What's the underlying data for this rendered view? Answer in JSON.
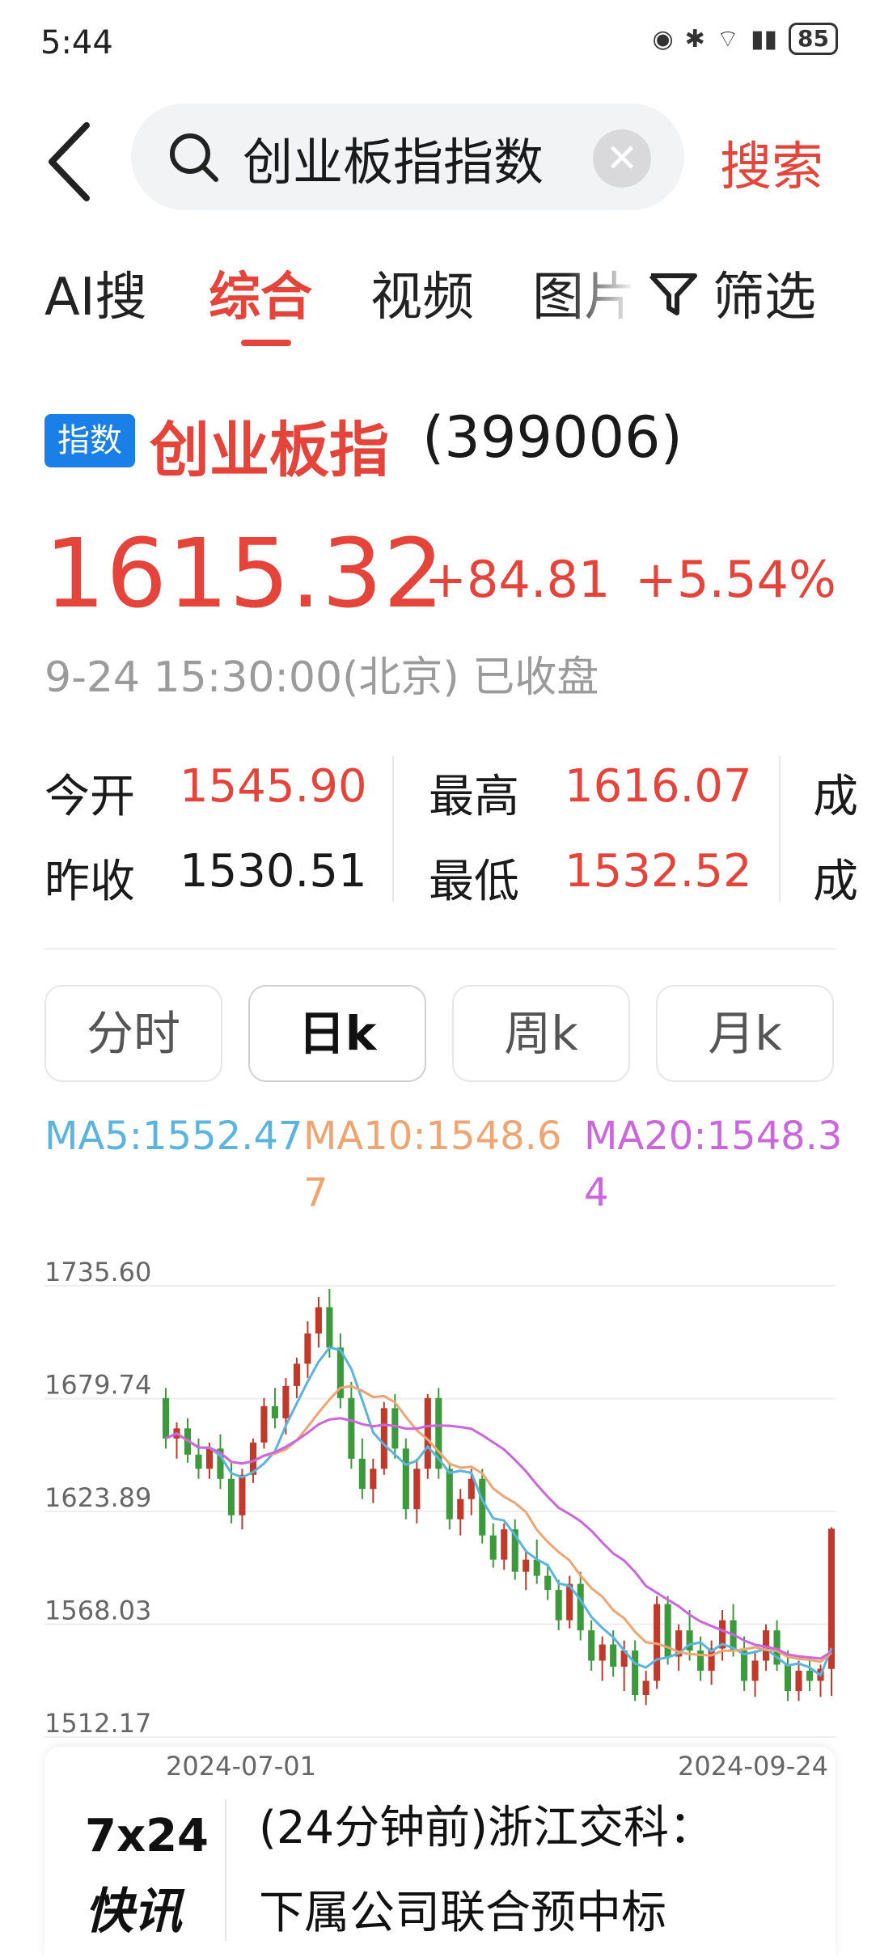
{
  "status": {
    "time": "5:44",
    "battery": "85"
  },
  "search": {
    "query": "创业板指指数",
    "button": "搜索"
  },
  "tabs": [
    "AI搜",
    "综合",
    "视频",
    "图片"
  ],
  "filter_label": "筛选",
  "quote": {
    "badge": "指数",
    "name": "创业板指",
    "code": "(399006)",
    "price": "1615.32",
    "change": "+84.81",
    "change_pct": "+5.54%",
    "time": "9-24 15:30:00(北京) 已收盘",
    "stats": {
      "open_label": "今开",
      "open": "1545.90",
      "high_label": "最高",
      "high": "1616.07",
      "prev_label": "昨收",
      "prev": "1530.51",
      "low_label": "最低",
      "low": "1532.52",
      "vol_label": "成",
      "amt_label": "成"
    }
  },
  "period_tabs": [
    "分时",
    "日k",
    "周k",
    "月k"
  ],
  "ma": {
    "ma5": "MA5:1552.47",
    "ma10": "MA10:1548.67",
    "ma20": "MA20:1548.34"
  },
  "colors": {
    "red": "#e5443b",
    "blue": "#1a7fe6",
    "up_candle": "#c0392b",
    "down_candle": "#3c9a3c",
    "ma5": "#5bb4dd",
    "ma10": "#efa572",
    "ma20": "#cc66dd"
  },
  "chart_data": {
    "type": "candlestick",
    "y_ticks": [
      "1735.60",
      "1679.74",
      "1623.89",
      "1568.03",
      "1512.17"
    ],
    "ylim": [
      1512.17,
      1735.6
    ],
    "x_labels": [
      "2024-07-01",
      "2024-09-24"
    ],
    "candles": [
      [
        1680,
        1685,
        1655,
        1660
      ],
      [
        1660,
        1668,
        1650,
        1665
      ],
      [
        1665,
        1670,
        1648,
        1652
      ],
      [
        1652,
        1660,
        1640,
        1645
      ],
      [
        1645,
        1658,
        1640,
        1655
      ],
      [
        1655,
        1662,
        1635,
        1640
      ],
      [
        1640,
        1648,
        1618,
        1622
      ],
      [
        1622,
        1645,
        1615,
        1642
      ],
      [
        1642,
        1660,
        1638,
        1658
      ],
      [
        1658,
        1680,
        1655,
        1676
      ],
      [
        1676,
        1685,
        1665,
        1670
      ],
      [
        1670,
        1690,
        1662,
        1686
      ],
      [
        1686,
        1700,
        1680,
        1697
      ],
      [
        1697,
        1718,
        1690,
        1712
      ],
      [
        1712,
        1730,
        1705,
        1725
      ],
      [
        1725,
        1734,
        1700,
        1705
      ],
      [
        1705,
        1712,
        1675,
        1680
      ],
      [
        1680,
        1688,
        1645,
        1650
      ],
      [
        1650,
        1660,
        1630,
        1635
      ],
      [
        1635,
        1650,
        1628,
        1645
      ],
      [
        1645,
        1678,
        1642,
        1675
      ],
      [
        1675,
        1682,
        1650,
        1655
      ],
      [
        1655,
        1660,
        1620,
        1625
      ],
      [
        1625,
        1650,
        1618,
        1645
      ],
      [
        1645,
        1682,
        1640,
        1680
      ],
      [
        1680,
        1685,
        1640,
        1645
      ],
      [
        1645,
        1648,
        1615,
        1620
      ],
      [
        1620,
        1635,
        1612,
        1630
      ],
      [
        1630,
        1645,
        1622,
        1640
      ],
      [
        1640,
        1645,
        1608,
        1612
      ],
      [
        1612,
        1618,
        1596,
        1600
      ],
      [
        1600,
        1618,
        1595,
        1615
      ],
      [
        1615,
        1620,
        1590,
        1594
      ],
      [
        1594,
        1605,
        1585,
        1600
      ],
      [
        1600,
        1610,
        1588,
        1592
      ],
      [
        1592,
        1598,
        1580,
        1585
      ],
      [
        1585,
        1590,
        1565,
        1570
      ],
      [
        1570,
        1592,
        1566,
        1588
      ],
      [
        1588,
        1594,
        1560,
        1565
      ],
      [
        1565,
        1570,
        1545,
        1550
      ],
      [
        1550,
        1562,
        1540,
        1558
      ],
      [
        1558,
        1565,
        1542,
        1547
      ],
      [
        1547,
        1560,
        1535,
        1555
      ],
      [
        1555,
        1560,
        1530,
        1533
      ],
      [
        1533,
        1545,
        1528,
        1540
      ],
      [
        1540,
        1582,
        1536,
        1578
      ],
      [
        1578,
        1582,
        1548,
        1552
      ],
      [
        1552,
        1568,
        1545,
        1565
      ],
      [
        1565,
        1575,
        1550,
        1555
      ],
      [
        1555,
        1562,
        1540,
        1545
      ],
      [
        1545,
        1560,
        1538,
        1556
      ],
      [
        1556,
        1575,
        1550,
        1570
      ],
      [
        1570,
        1578,
        1552,
        1555
      ],
      [
        1555,
        1562,
        1535,
        1540
      ],
      [
        1540,
        1555,
        1532,
        1550
      ],
      [
        1550,
        1568,
        1545,
        1565
      ],
      [
        1565,
        1570,
        1545,
        1548
      ],
      [
        1548,
        1555,
        1530,
        1535
      ],
      [
        1535,
        1550,
        1530,
        1545
      ],
      [
        1545,
        1552,
        1535,
        1540
      ],
      [
        1540,
        1548,
        1532,
        1546
      ],
      [
        1545.9,
        1616.07,
        1532.52,
        1615.32
      ]
    ]
  },
  "news": {
    "logo_line1": "7x24",
    "logo_line2": "快讯",
    "line1": "(24分钟前)浙江交科：",
    "line2": "下属公司联合预中标"
  }
}
